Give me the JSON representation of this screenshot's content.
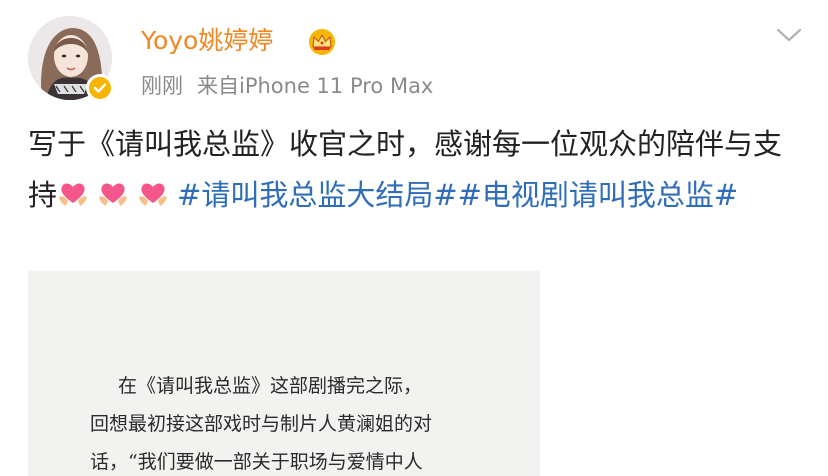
{
  "user": {
    "name": "Yoyo姚婷婷",
    "timestamp": "刚刚",
    "source": "来自iPhone 11 Pro Max",
    "badge_color": "#f7b500",
    "name_color": "#f08822"
  },
  "icons": {
    "vip_badge": "crown-icon",
    "verified": "verified-icon",
    "menu": "chevron-down-icon",
    "emoji": "heart-hands-emoji"
  },
  "post": {
    "text": "写于《请叫我总监》收官之时，感谢每一位观众的陪伴与支持",
    "emoji_count": 3,
    "hashtag_1": "#请叫我总监大结局#",
    "hashtag_2": "#电视剧请叫我总监#",
    "hashtag_color": "#2f6db8"
  },
  "image": {
    "lines": [
      "在《请叫我总监》这部剧播完之际，",
      "回想最初接这部戏时与制片人黄澜姐的对",
      "话，“我们要做一部关于职场与爱情中人"
    ]
  }
}
